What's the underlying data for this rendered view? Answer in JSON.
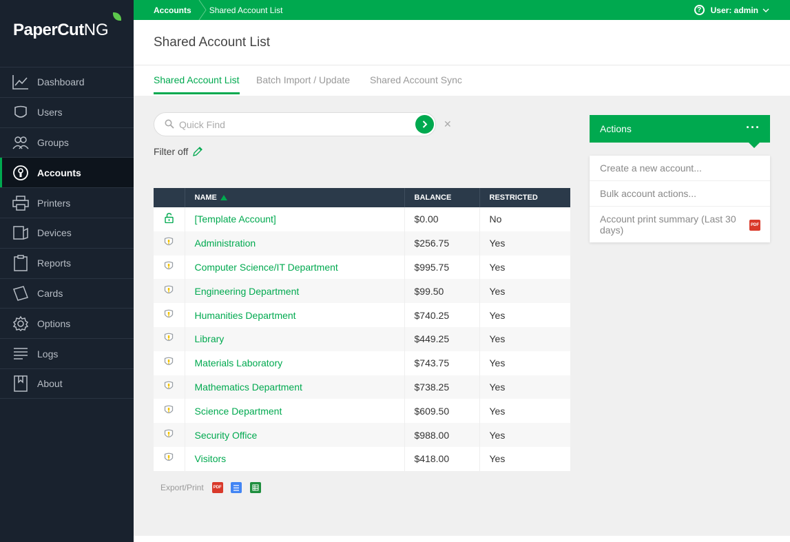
{
  "brand": {
    "name_paper": "PaperCut",
    "name_ng": "NG"
  },
  "sidebar": {
    "items": [
      {
        "label": "Dashboard",
        "icon": "dashboard-icon",
        "active": false
      },
      {
        "label": "Users",
        "icon": "users-icon",
        "active": false
      },
      {
        "label": "Groups",
        "icon": "groups-icon",
        "active": false
      },
      {
        "label": "Accounts",
        "icon": "accounts-icon",
        "active": true
      },
      {
        "label": "Printers",
        "icon": "printers-icon",
        "active": false
      },
      {
        "label": "Devices",
        "icon": "devices-icon",
        "active": false
      },
      {
        "label": "Reports",
        "icon": "reports-icon",
        "active": false
      },
      {
        "label": "Cards",
        "icon": "cards-icon",
        "active": false
      },
      {
        "label": "Options",
        "icon": "options-icon",
        "active": false
      },
      {
        "label": "Logs",
        "icon": "logs-icon",
        "active": false
      },
      {
        "label": "About",
        "icon": "about-icon",
        "active": false
      }
    ]
  },
  "topbar": {
    "breadcrumb": [
      "Accounts",
      "Shared Account List"
    ],
    "user_label": "User: admin"
  },
  "header": {
    "title": "Shared Account List",
    "tabs": [
      {
        "label": "Shared Account List",
        "active": true
      },
      {
        "label": "Batch Import / Update",
        "active": false
      },
      {
        "label": "Shared Account Sync",
        "active": false
      }
    ]
  },
  "search": {
    "placeholder": "Quick Find",
    "value": ""
  },
  "filter": {
    "label": "Filter off"
  },
  "table": {
    "columns": [
      "",
      "NAME",
      "BALANCE",
      "RESTRICTED"
    ],
    "rows": [
      {
        "icon": "unlocked-icon",
        "name": "[Template Account]",
        "balance": "$0.00",
        "restricted": "No"
      },
      {
        "icon": "shield-icon",
        "name": "Administration",
        "balance": "$256.75",
        "restricted": "Yes"
      },
      {
        "icon": "shield-icon",
        "name": "Computer Science/IT Department",
        "balance": "$995.75",
        "restricted": "Yes"
      },
      {
        "icon": "shield-icon",
        "name": "Engineering Department",
        "balance": "$99.50",
        "restricted": "Yes"
      },
      {
        "icon": "shield-icon",
        "name": "Humanities Department",
        "balance": "$740.25",
        "restricted": "Yes"
      },
      {
        "icon": "shield-icon",
        "name": "Library",
        "balance": "$449.25",
        "restricted": "Yes"
      },
      {
        "icon": "shield-icon",
        "name": "Materials Laboratory",
        "balance": "$743.75",
        "restricted": "Yes"
      },
      {
        "icon": "shield-icon",
        "name": "Mathematics Department",
        "balance": "$738.25",
        "restricted": "Yes"
      },
      {
        "icon": "shield-icon",
        "name": "Science Department",
        "balance": "$609.50",
        "restricted": "Yes"
      },
      {
        "icon": "shield-icon",
        "name": "Security Office",
        "balance": "$988.00",
        "restricted": "Yes"
      },
      {
        "icon": "shield-icon",
        "name": "Visitors",
        "balance": "$418.00",
        "restricted": "Yes"
      }
    ]
  },
  "export": {
    "label": "Export/Print",
    "pdf_text": "PDF"
  },
  "actions": {
    "title": "Actions",
    "dots": "···",
    "items": [
      {
        "label": "Create a new account..."
      },
      {
        "label": "Bulk account actions..."
      },
      {
        "label": "Account print summary (Last 30 days)",
        "badge": "PDF"
      }
    ]
  },
  "colors": {
    "accent": "#00a94f",
    "sidebar": "#19222e",
    "table_header": "#2b3a4a",
    "pdf": "#d9392a"
  }
}
